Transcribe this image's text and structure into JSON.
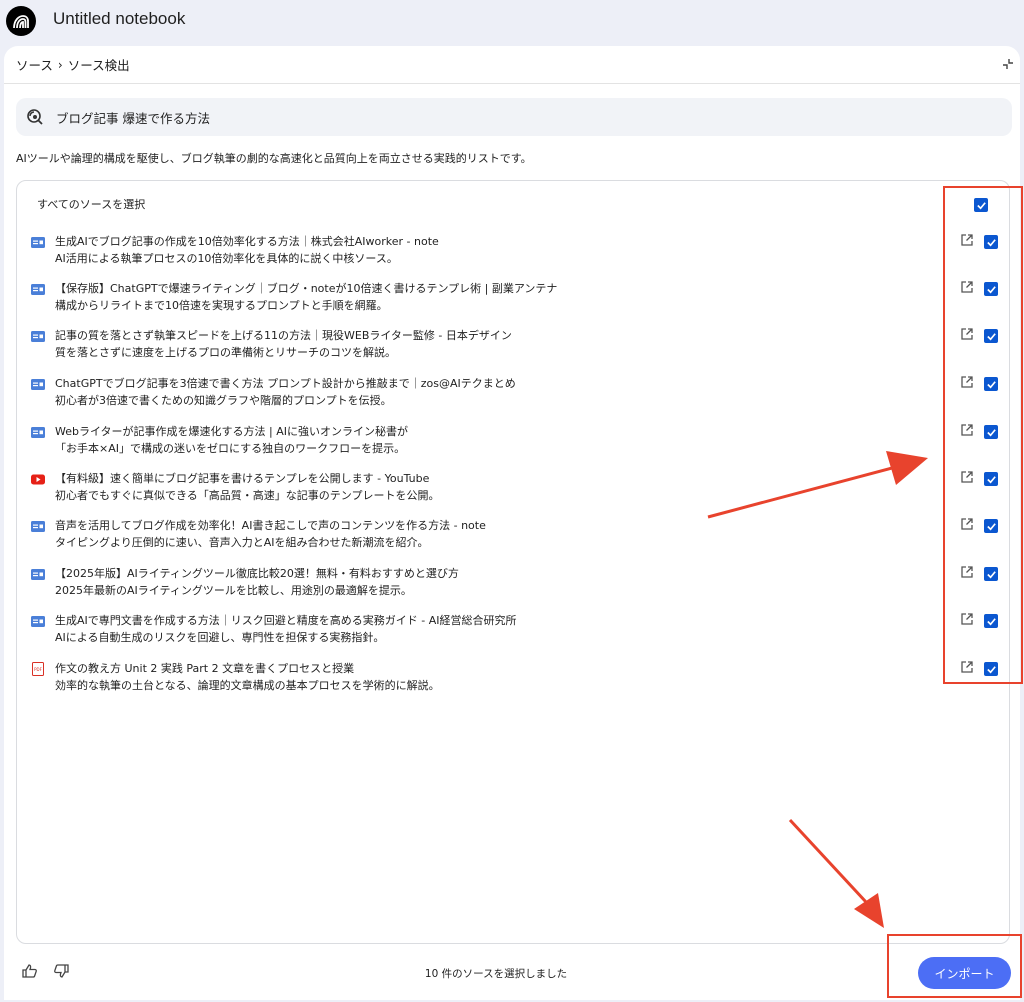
{
  "app": {
    "title": "Untitled notebook"
  },
  "breadcrumb": {
    "parent": "ソース",
    "current": "ソース検出"
  },
  "query": {
    "text": "ブログ記事 爆速で作る方法"
  },
  "summary": "AIツールや論理的構成を駆使し、ブログ執筆の劇的な高速化と品質向上を両立させる実践的リストです。",
  "select_all": {
    "label": "すべてのソースを選択",
    "checked": true
  },
  "colors": {
    "accent": "#0b57d0",
    "import_button": "#4c6ef5",
    "annotation": "#e8432d",
    "youtube": "#e62117",
    "pdf": "#d93025",
    "web": "#4a7fd8"
  },
  "sources": [
    {
      "type": "web",
      "icon": "web-icon",
      "title": "生成AIでブログ記事の作成を10倍効率化する方法｜株式会社AIworker - note",
      "desc": "AI活用による執筆プロセスの10倍効率化を具体的に説く中核ソース。",
      "checked": true
    },
    {
      "type": "web",
      "icon": "web-icon",
      "title": "【保存版】ChatGPTで爆速ライティング｜ブログ・noteが10倍速く書けるテンプレ術 | 副業アンテナ",
      "desc": "構成からリライトまで10倍速を実現するプロンプトと手順を網羅。",
      "checked": true
    },
    {
      "type": "web",
      "icon": "web-icon",
      "title": "記事の質を落とさず執筆スピードを上げる11の方法｜現役WEBライター監修 - 日本デザイン",
      "desc": "質を落とさずに速度を上げるプロの準備術とリサーチのコツを解説。",
      "checked": true
    },
    {
      "type": "web",
      "icon": "web-icon",
      "title": "ChatGPTでブログ記事を3倍速で書く方法 プロンプト設計から推敲まで｜zos@AIテクまとめ",
      "desc": "初心者が3倍速で書くための知識グラフや階層的プロンプトを伝授。",
      "checked": true
    },
    {
      "type": "web",
      "icon": "web-icon",
      "title": "Webライターが記事作成を爆速化する方法 | AIに強いオンライン秘書が",
      "desc": "「お手本×AI」で構成の迷いをゼロにする独自のワークフローを提示。",
      "checked": true
    },
    {
      "type": "youtube",
      "icon": "youtube-icon",
      "title": "【有料級】速く簡単にブログ記事を書けるテンプレを公開します - YouTube",
      "desc": "初心者でもすぐに真似できる「高品質・高速」な記事のテンプレートを公開。",
      "checked": true
    },
    {
      "type": "web",
      "icon": "web-icon",
      "title": "音声を活用してブログ作成を効率化！AI書き起こしで声のコンテンツを作る方法 - note",
      "desc": "タイピングより圧倒的に速い、音声入力とAIを組み合わせた新潮流を紹介。",
      "checked": true
    },
    {
      "type": "web",
      "icon": "web-icon",
      "title": "【2025年版】AIライティングツール徹底比較20選！無料・有料おすすめと選び方",
      "desc": "2025年最新のAIライティングツールを比較し、用途別の最適解を提示。",
      "checked": true
    },
    {
      "type": "web",
      "icon": "web-icon",
      "title": "生成AIで専門文書を作成する方法｜リスク回避と精度を高める実務ガイド - AI経営総合研究所",
      "desc": "AIによる自動生成のリスクを回避し、専門性を担保する実務指針。",
      "checked": true
    },
    {
      "type": "pdf",
      "icon": "pdf-icon",
      "title": "作文の教え方 Unit 2 実践 Part 2 文章を書くプロセスと授業",
      "desc": "効率的な執筆の土台となる、論理的文章構成の基本プロセスを学術的に解説。",
      "checked": true
    }
  ],
  "footer": {
    "selected_count": "10 件のソースを選択しました",
    "import_label": "インポート"
  }
}
